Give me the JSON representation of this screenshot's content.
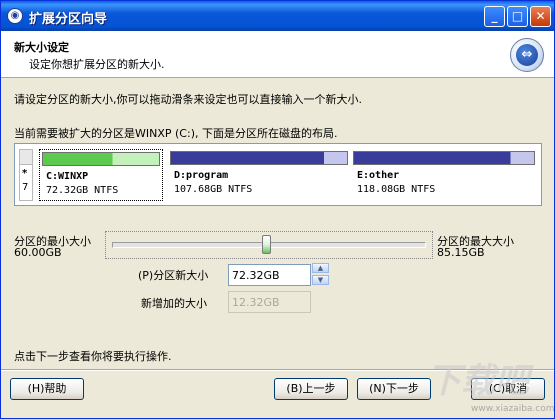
{
  "window": {
    "title": "扩展分区向导",
    "app_icon": "partition-tool-icon"
  },
  "title_buttons": {
    "minimize": "_",
    "maximize": "□",
    "close": "✕"
  },
  "header": {
    "title": "新大小设定",
    "subtitle": "设定你想扩展分区的新大小.",
    "icon": "double-arrow-icon",
    "icon_glyph": "⇔"
  },
  "body": {
    "instruction": "请设定分区的新大小,你可以拖动滑条来设定也可以直接输入一个新大小.",
    "partition_info": "当前需要被扩大的分区是WINXP (C:), 下面是分区所在磁盘的布局."
  },
  "disk": {
    "index_label": "*",
    "index_number": "7",
    "partitions": [
      {
        "name": "C:WINXP",
        "detail": "72.32GB NTFS",
        "used_fraction": 0.6,
        "fill_color": "#5CCB4D",
        "free_color": "#C4F0BC",
        "selected": true
      },
      {
        "name": "D:program",
        "detail": "107.68GB NTFS",
        "used_fraction": 0.87,
        "fill_color": "#3A3C9C",
        "free_color": "#C5C6EE",
        "selected": false
      },
      {
        "name": "E:other",
        "detail": "118.08GB NTFS",
        "used_fraction": 0.87,
        "fill_color": "#3A3C9C",
        "free_color": "#C5C6EE",
        "selected": false
      }
    ]
  },
  "size": {
    "min_label": "分区的最小大小",
    "min_value": "60.00GB",
    "max_label": "分区的最大大小",
    "max_value": "85.15GB",
    "new_size_label": "(P)分区新大小",
    "new_size_value": "72.32GB",
    "added_label": "新增加的大小",
    "added_value": "12.32GB"
  },
  "footer": {
    "hint": "点击下一步查看你将要执行操作."
  },
  "buttons": {
    "help": "(H)帮助",
    "back": "(B)上一步",
    "next": "(N)下一步",
    "cancel": "(C)取消"
  },
  "watermark": {
    "text": "下载吧",
    "url": "www.xiazaiba.com"
  }
}
